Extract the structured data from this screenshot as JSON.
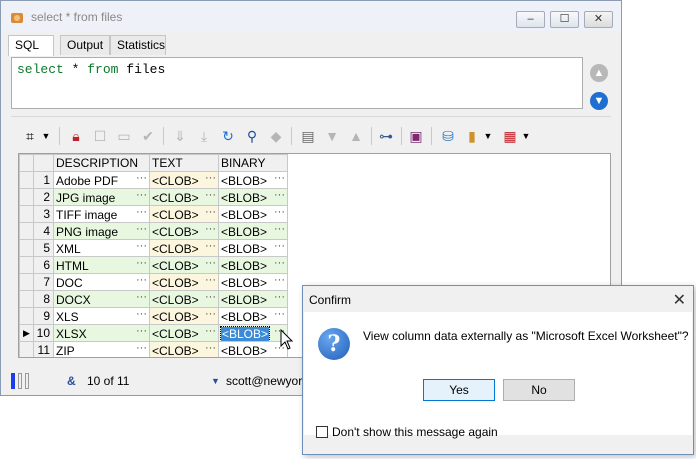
{
  "window": {
    "title": "select * from files",
    "minimize_label": "–",
    "maximize_label": "☐",
    "close_label": "✕"
  },
  "tabs": [
    "SQL",
    "Output",
    "Statistics"
  ],
  "sql": {
    "kw_select": "select",
    "star": "*",
    "kw_from": "from",
    "table": "files"
  },
  "toolbar_icons": [
    "grid-options-icon",
    "lock-icon",
    "new-record-icon",
    "cancel-edit-icon",
    "apply-icon",
    "filter-down-icon",
    "filter-all-icon",
    "refresh-icon",
    "find-icon",
    "eraser-icon",
    "single-record-icon",
    "sort-desc-icon",
    "sort-asc-icon",
    "tree-icon",
    "save-icon",
    "export-db-icon",
    "chart-icon",
    "table-grid-icon"
  ],
  "grid": {
    "columns": [
      "DESCRIPTION",
      "TEXT",
      "BINARY"
    ],
    "ellipsis": "···",
    "rows": [
      {
        "n": "1",
        "desc": "Adobe PDF",
        "text": "<CLOB>",
        "bin": "<BLOB>"
      },
      {
        "n": "2",
        "desc": "JPG image",
        "text": "<CLOB>",
        "bin": "<BLOB>"
      },
      {
        "n": "3",
        "desc": "TIFF image",
        "text": "<CLOB>",
        "bin": "<BLOB>"
      },
      {
        "n": "4",
        "desc": "PNG image",
        "text": "<CLOB>",
        "bin": "<BLOB>"
      },
      {
        "n": "5",
        "desc": "XML",
        "text": "<CLOB>",
        "bin": "<BLOB>"
      },
      {
        "n": "6",
        "desc": "HTML",
        "text": "<CLOB>",
        "bin": "<BLOB>"
      },
      {
        "n": "7",
        "desc": "DOC",
        "text": "<CLOB>",
        "bin": "<BLOB>"
      },
      {
        "n": "8",
        "desc": "DOCX",
        "text": "<CLOB>",
        "bin": "<BLOB>"
      },
      {
        "n": "9",
        "desc": "XLS",
        "text": "<CLOB>",
        "bin": "<BLOB>"
      },
      {
        "n": "10",
        "desc": "XLSX",
        "text": "<CLOB>",
        "bin": "<BLOB>"
      },
      {
        "n": "11",
        "desc": "ZIP",
        "text": "<CLOB>",
        "bin": "<BLOB>"
      }
    ],
    "current_row_marker": "▶"
  },
  "status": {
    "record": "10 of 11",
    "connection": "scott@newyor"
  },
  "dialog": {
    "title": "Confirm",
    "close": "✕",
    "icon": "?",
    "message": "View column data externally as \"Microsoft Excel Worksheet\"?",
    "yes": "Yes",
    "no": "No",
    "checkbox_label": "Don't show this message again"
  },
  "colors": {
    "accent": "#0078d7",
    "keyword": "#0a7a2a",
    "selection": "#3b8bd8"
  }
}
